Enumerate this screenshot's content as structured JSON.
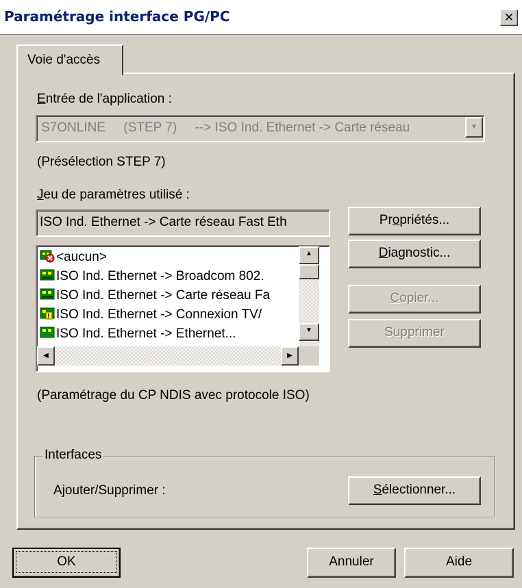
{
  "window": {
    "title": "Paramétrage interface PG/PC",
    "close_label": "x"
  },
  "tab": {
    "label": "Voie d'accès"
  },
  "app_entry": {
    "label_prefix": "E",
    "label_rest": "ntrée de l'application :",
    "value": "S7ONLINE     (STEP 7)     --> ISO Ind. Ethernet -> Carte réseau",
    "note": "(Présélection STEP 7)"
  },
  "param_set": {
    "label_prefix": "J",
    "label_rest": "eu de paramètres utilisé :",
    "value": "ISO Ind. Ethernet -> Carte réseau Fast Eth"
  },
  "param_list": {
    "items": [
      {
        "label": "<aucun>",
        "icon": "no-interface-icon"
      },
      {
        "label": "ISO Ind. Ethernet -> Broadcom 802.",
        "icon": "network-card-icon"
      },
      {
        "label": "ISO Ind. Ethernet -> Carte réseau Fa",
        "icon": "network-card-icon"
      },
      {
        "label": "ISO Ind. Ethernet -> Connexion TV/",
        "icon": "network-card-warning-icon"
      },
      {
        "label": "ISO Ind. Ethernet -> Ethernet...",
        "icon": "network-card-icon"
      }
    ],
    "description": "(Paramétrage du CP NDIS avec protocole ISO)"
  },
  "buttons": {
    "properties": {
      "pre": "Pr",
      "ul": "o",
      "post": "priétés..."
    },
    "diagnostic": {
      "pre": "",
      "ul": "D",
      "post": "iagnostic..."
    },
    "copy": {
      "pre": "",
      "ul": "C",
      "post": "opier..."
    },
    "delete": {
      "pre": "S",
      "ul": "u",
      "post": "pprimer"
    },
    "select": {
      "pre": "",
      "ul": "S",
      "post": "électionner..."
    },
    "ok": "OK",
    "cancel": "Annuler",
    "help": "Aide"
  },
  "interfaces": {
    "legend": "Interfaces",
    "add_remove_label": "Ajouter/Supprimer :"
  }
}
